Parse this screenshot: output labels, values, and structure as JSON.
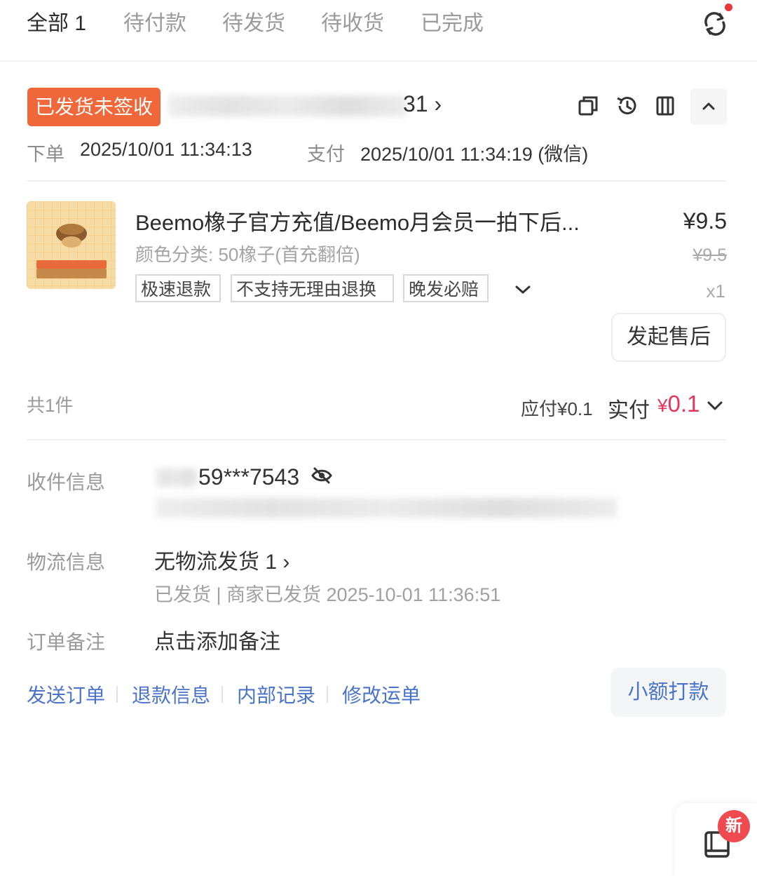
{
  "tabs": [
    {
      "label": "全部 1",
      "active": true
    },
    {
      "label": "待付款",
      "active": false
    },
    {
      "label": "待发货",
      "active": false
    },
    {
      "label": "待收货",
      "active": false
    },
    {
      "label": "已完成",
      "active": false
    }
  ],
  "order": {
    "status": "已发货未签收",
    "id_suffix": "31",
    "order_time_label": "下单",
    "order_time": "2025/10/01 11:34:13",
    "pay_time_label": "支付",
    "pay_time": "2025/10/01 11:34:19 (微信)"
  },
  "product": {
    "title": "Beemo橡子官方充值/Beemo月会员一拍下后...",
    "spec": "颜色分类: 50橡子(首充翻倍)",
    "tags": [
      "极速退款",
      "不支持无理由退换",
      "晚发必赔"
    ],
    "price": "¥9.5",
    "original_price": "¥9.5",
    "quantity": "x1",
    "after_sale_button": "发起售后"
  },
  "totals": {
    "count": "共1件",
    "payable": "应付¥0.1",
    "paid_label": "实付",
    "paid_currency": "¥",
    "paid_amount": "0.1"
  },
  "info": {
    "receiver_label": "收件信息",
    "receiver_phone": "59***7543",
    "logistics_label": "物流信息",
    "logistics_value": "无物流发货 1",
    "logistics_status": "已发货 | 商家已发货  2025-10-01 11:36:51",
    "remark_label": "订单备注",
    "remark_value": "点击添加备注"
  },
  "actions": {
    "links": [
      "发送订单",
      "退款信息",
      "内部记录",
      "修改运单"
    ],
    "small_payment": "小额打款"
  },
  "floating": {
    "badge": "新"
  },
  "colors": {
    "status_badge": "#f0673a",
    "link": "#4a74c9",
    "paid_amount": "#e8335a",
    "new_badge": "#ee4a4f"
  }
}
